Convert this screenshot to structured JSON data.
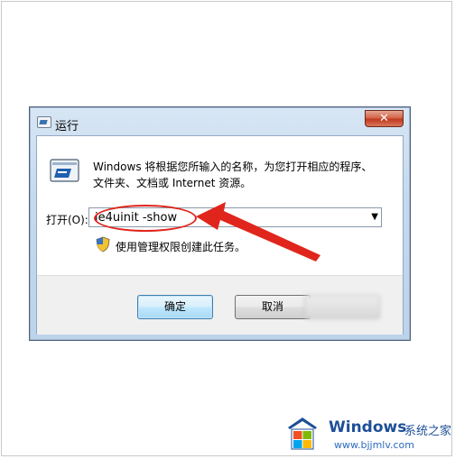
{
  "window": {
    "title": "运行",
    "close_glyph": "✕"
  },
  "description": {
    "line1": "Windows 将根据您所输入的名称，为您打开相应的程序、",
    "line2": "文件夹、文档或 Internet 资源。"
  },
  "open_field": {
    "label": "打开(O):",
    "value": "ie4uinit -show",
    "dropdown_glyph": "▼"
  },
  "admin_notice": "使用管理权限创建此任务。",
  "buttons": {
    "ok": "确定",
    "cancel": "取消"
  },
  "annotation": {
    "color": "#e0261c"
  },
  "watermark": {
    "brand": "Windows",
    "site_cn": "系统之家",
    "url": "www.bjjmlv.com"
  },
  "colors": {
    "close_button": "#c0391f",
    "ok_button_border": "#3c7fb1",
    "watermark_blue": "#1d4f97"
  }
}
